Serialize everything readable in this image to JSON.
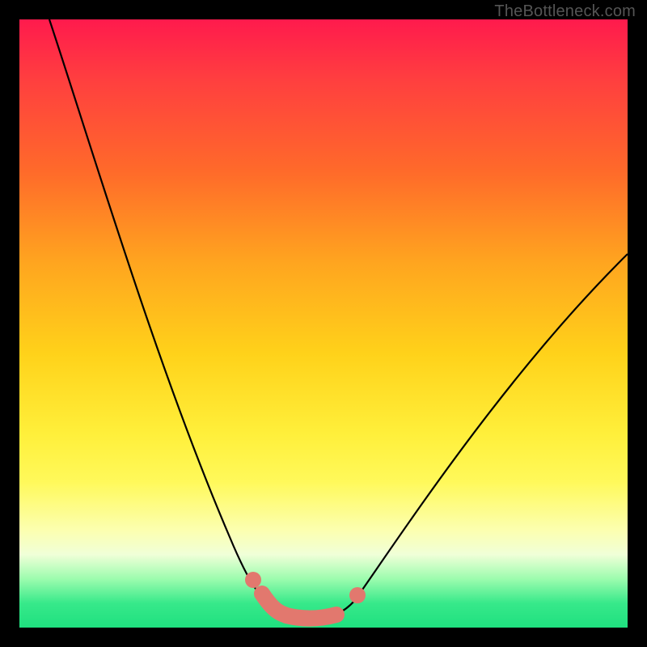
{
  "attribution": "TheBottleneck.com",
  "chart_data": {
    "type": "line",
    "title": "",
    "xlabel": "",
    "ylabel": "",
    "xlim": [
      0,
      100
    ],
    "ylim": [
      0,
      100
    ],
    "series": [
      {
        "name": "bottleneck-curve",
        "x": [
          5,
          10,
          15,
          20,
          25,
          30,
          35,
          38,
          40,
          42,
          44,
          46,
          48,
          52,
          55,
          60,
          65,
          70,
          75,
          80,
          85,
          90,
          95,
          100
        ],
        "values": [
          100,
          86,
          72,
          58,
          44,
          30,
          16,
          8,
          4,
          2,
          1,
          1,
          1,
          2,
          4,
          8,
          14,
          20,
          27,
          34,
          41,
          48,
          55,
          61
        ]
      }
    ],
    "optimal_range_x": [
      40,
      53
    ],
    "background_gradient": {
      "top": "#ff1a4d",
      "mid": "#ffef3a",
      "bottom": "#1fe07f"
    },
    "highlight_color": "#e2786e",
    "curve_color": "#000000"
  }
}
